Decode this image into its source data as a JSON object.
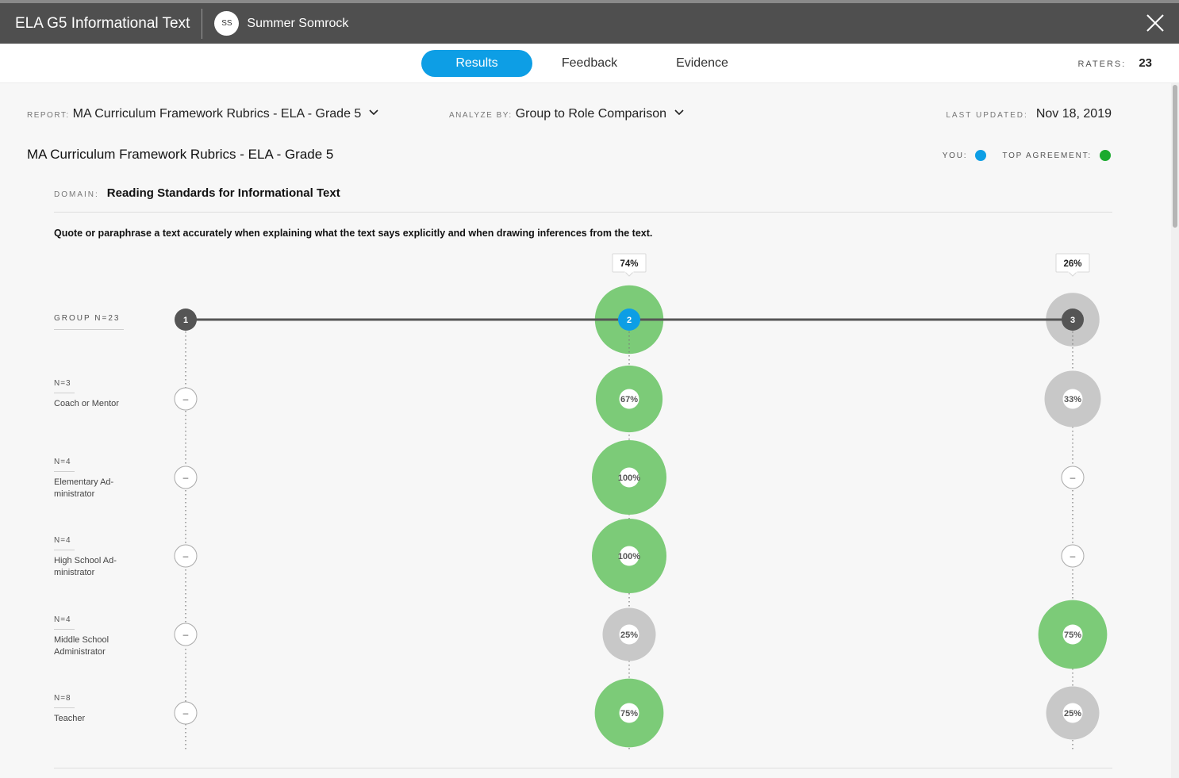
{
  "header": {
    "title": "ELA G5 Informational Text",
    "user_initials": "SS",
    "user_name": "Summer Somrock"
  },
  "tabs": [
    {
      "label": "Results",
      "active": true
    },
    {
      "label": "Feedback",
      "active": false
    },
    {
      "label": "Evidence",
      "active": false
    }
  ],
  "raters": {
    "label": "RATERS:",
    "value": "23"
  },
  "report": {
    "label": "REPORT:",
    "value": "MA Curriculum Framework Rubrics - ELA - Grade 5"
  },
  "analyze_by": {
    "label": "ANALYZE BY:",
    "value": "Group to Role Comparison"
  },
  "last_updated": {
    "label": "LAST UPDATED:",
    "value": "Nov 18, 2019"
  },
  "report_title": "MA Curriculum Framework Rubrics - ELA - Grade 5",
  "legend": {
    "you_label": "YOU:",
    "top_label": "TOP AGREEMENT:",
    "you_color": "#0d9ee5",
    "top_color": "#1aaa2e"
  },
  "domain": {
    "label": "DOMAIN:",
    "value": "Reading Standards for Informational Text"
  },
  "standard": "Quote or paraphrase a text accurately when explaining what the text says explicitly and when drawing inferences from the text.",
  "colors": {
    "green": "#7ccb78",
    "gray": "#c8c8c8",
    "dark": "#555555",
    "blue": "#0d9ee5"
  },
  "chart_data": {
    "type": "bubble-agreement",
    "levels": [
      "1",
      "2",
      "3"
    ],
    "group": {
      "label": "GROUP N=23",
      "percents": [
        null,
        74,
        26
      ],
      "percent_labels": [
        "",
        "74%",
        "26%"
      ],
      "you_level": 2,
      "top_level": 2
    },
    "roles": [
      {
        "n": "N=3",
        "name": "Coach or Mentor",
        "percents": [
          0,
          67,
          33
        ],
        "labels": [
          "–",
          "67%",
          "33%"
        ]
      },
      {
        "n": "N=4",
        "name": "Elementary Ad-ministrator",
        "percents": [
          0,
          100,
          0
        ],
        "labels": [
          "–",
          "100%",
          "–"
        ]
      },
      {
        "n": "N=4",
        "name": "High School Ad-ministrator",
        "percents": [
          0,
          100,
          0
        ],
        "labels": [
          "–",
          "100%",
          "–"
        ]
      },
      {
        "n": "N=4",
        "name": "Middle School Administrator",
        "percents": [
          0,
          25,
          75
        ],
        "labels": [
          "–",
          "25%",
          "75%"
        ]
      },
      {
        "n": "N=8",
        "name": "Teacher",
        "percents": [
          0,
          75,
          25
        ],
        "labels": [
          "–",
          "75%",
          "25%"
        ]
      }
    ]
  }
}
